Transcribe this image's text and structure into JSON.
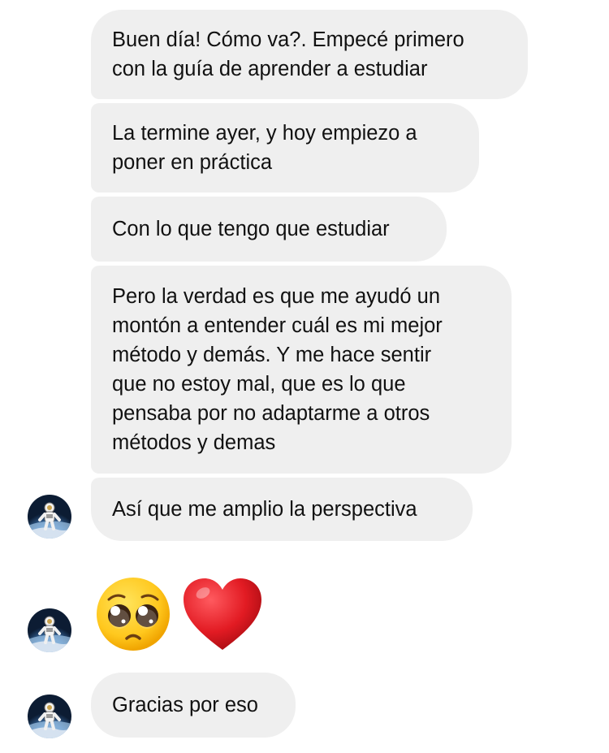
{
  "conversation": {
    "messages": [
      {
        "text": "Buen día! Cómo va?. Empecé primero\ncon la guía de aprender a estudiar"
      },
      {
        "text": "La termine ayer, y hoy empiezo a\nponer en práctica"
      },
      {
        "text": "Con lo que tengo que estudiar"
      },
      {
        "text": "Pero la verdad es que me ayudó un\nmontón a entender cuál es mi mejor\nmétodo y demás. Y me hace sentir\nque no estoy mal, que es lo que\npensaba por no adaptarme a otros\nmétodos y demas"
      },
      {
        "text": "Así que me amplio la perspectiva"
      },
      {
        "emoji": [
          "pleading-face",
          "red-heart"
        ]
      },
      {
        "text": "Gracias por eso"
      }
    ]
  },
  "sender": {
    "avatar_icon": "astronaut-avatar"
  },
  "colors": {
    "bubble_background": "#efefef",
    "text": "#111111",
    "background": "#ffffff"
  }
}
